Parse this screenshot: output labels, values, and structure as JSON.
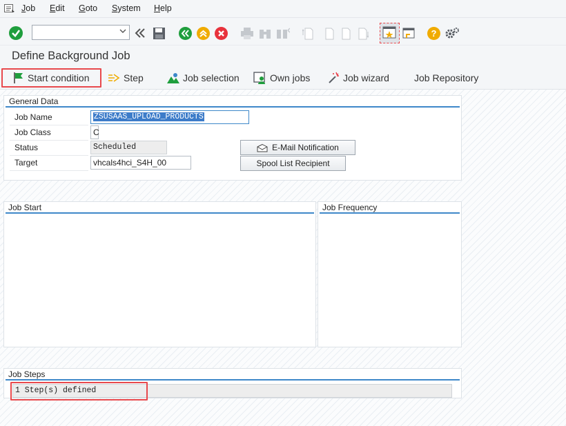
{
  "menu": {
    "items": [
      {
        "accel": "J",
        "rest": "ob"
      },
      {
        "accel": "E",
        "rest": "dit"
      },
      {
        "accel": "G",
        "rest": "oto"
      },
      {
        "accel": "S",
        "rest": "ystem"
      },
      {
        "accel": "H",
        "rest": "elp"
      }
    ]
  },
  "toolbar": {
    "command_field_value": "",
    "colors": {
      "green": "#1f9e3d",
      "yellow": "#f0ab00",
      "red": "#e8323c",
      "blue": "#3d87c9"
    }
  },
  "page": {
    "title": "Define Background Job"
  },
  "app_toolbar": {
    "start_condition": "Start condition",
    "step": "Step",
    "job_selection": "Job selection",
    "own_jobs": "Own jobs",
    "job_wizard": "Job wizard",
    "job_repository": "Job Repository"
  },
  "general_data": {
    "title": "General Data",
    "job_name_label": "Job Name",
    "job_name_value": "ZSUSAAS_UPLOAD_PRODUCTS",
    "job_class_label": "Job Class",
    "job_class_value": "C",
    "status_label": "Status",
    "status_value": "Scheduled",
    "target_label": "Target",
    "target_value": "vhcals4hci_S4H_00",
    "email_button": "E-Mail Notification",
    "spool_button": "Spool List Recipient"
  },
  "job_start": {
    "title": "Job Start"
  },
  "job_frequency": {
    "title": "Job Frequency"
  },
  "job_steps": {
    "title": "Job Steps",
    "steps_text": "1 Step(s) defined"
  }
}
